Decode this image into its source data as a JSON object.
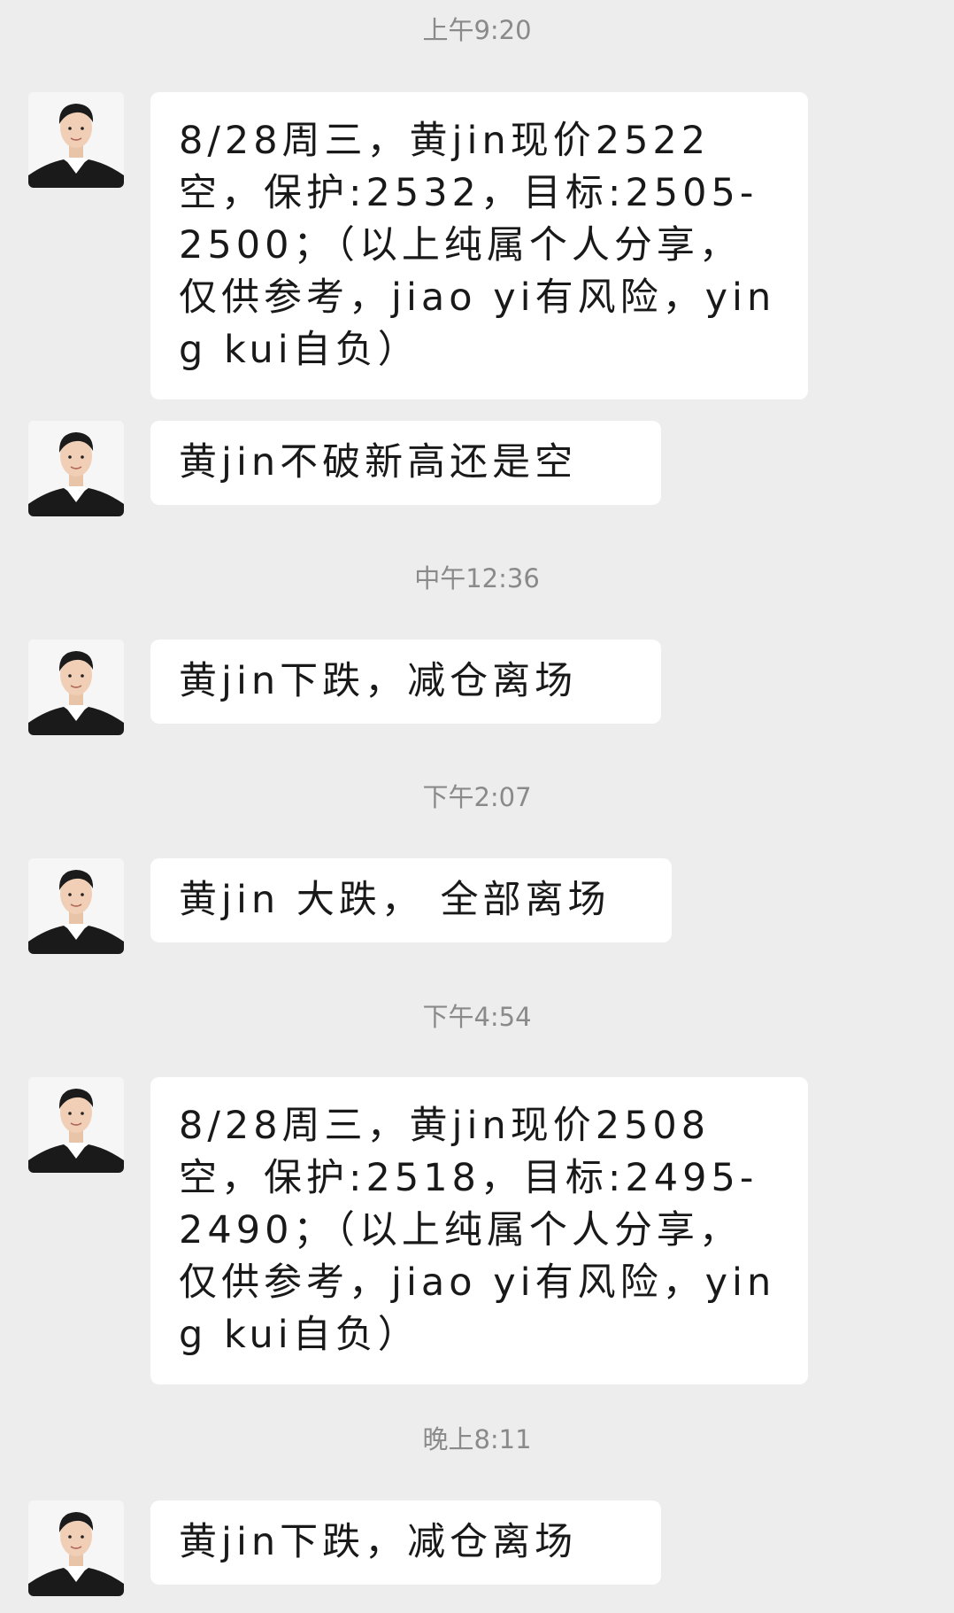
{
  "chat": {
    "timestamps": [
      "上午9:20",
      "中午12:36",
      "下午2:07",
      "下午4:54",
      "晚上8:11"
    ],
    "messages": [
      {
        "text": "8/28周三，黄jin现价2522空，保护:2532，目标:2505-2500；（以上纯属个人分享，仅供参考，jiao yi有风险，ying kui自负）"
      },
      {
        "text": "黄jin不破新高还是空"
      },
      {
        "text": "黄jin下跌，减仓离场"
      },
      {
        "text": "黄jin 大跌， 全部离场"
      },
      {
        "text": "8/28周三，黄jin现价2508空，保护:2518，目标:2495-2490；（以上纯属个人分享，仅供参考，jiao yi有风险，ying kui自负）"
      },
      {
        "text": "黄jin下跌，减仓离场"
      }
    ],
    "avatar_icon": "user-avatar-photo"
  }
}
